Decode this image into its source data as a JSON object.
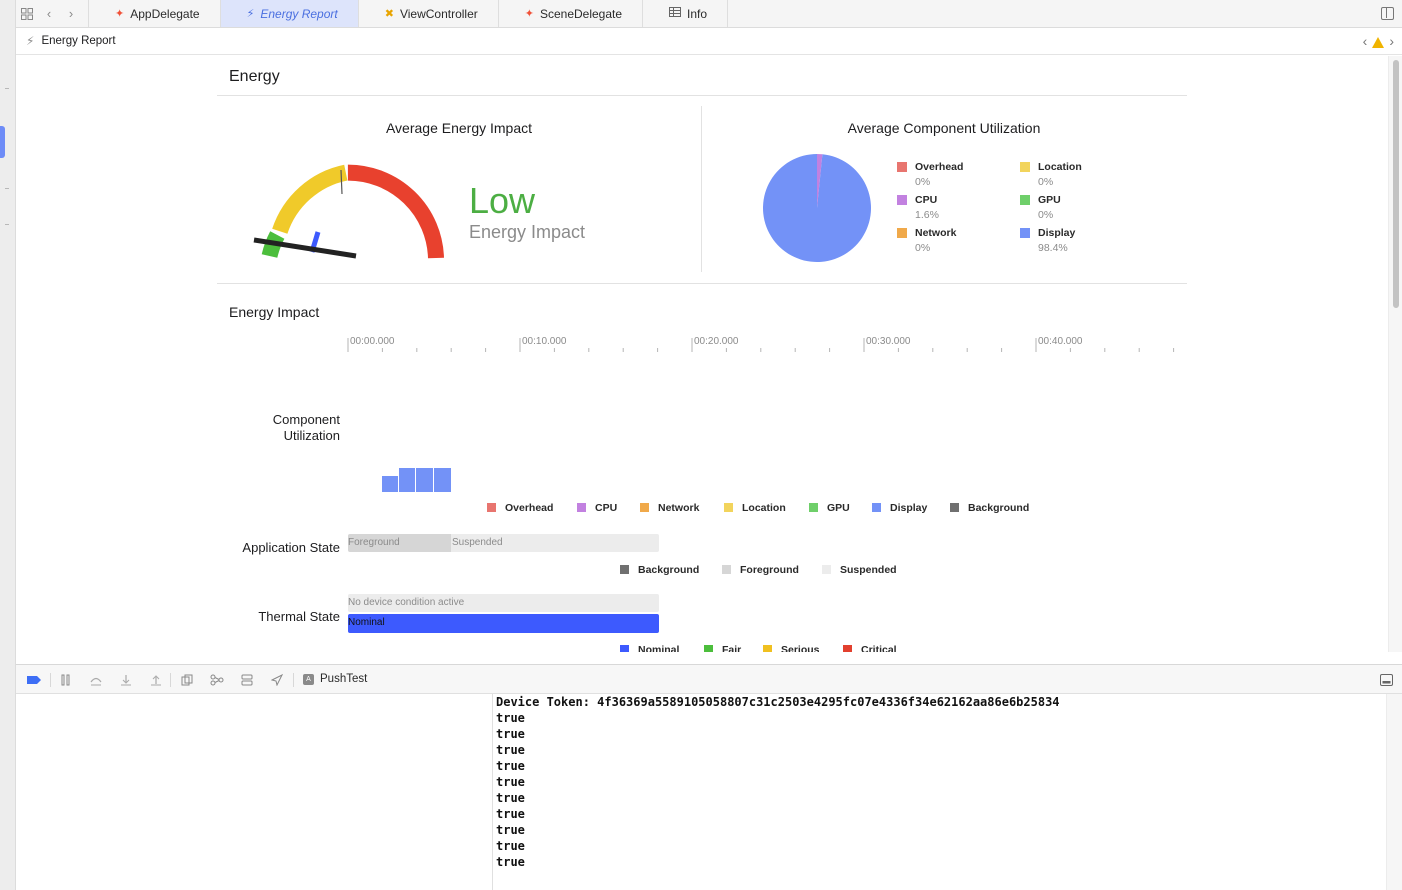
{
  "tabbar": {
    "tabs": [
      {
        "label": "AppDelegate",
        "icon": "swift-icon",
        "color": "#f05138"
      },
      {
        "label": "Energy Report",
        "icon": "bolt-icon",
        "active": true
      },
      {
        "label": "ViewController",
        "icon": "xib-icon",
        "color": "#e8a400"
      },
      {
        "label": "SceneDelegate",
        "icon": "swift-icon",
        "color": "#f05138"
      },
      {
        "label": "Info",
        "icon": "table-icon"
      }
    ]
  },
  "breadcrumb": {
    "label": "Energy Report"
  },
  "energy": {
    "title": "Energy",
    "avg_impact_heading": "Average Energy Impact",
    "impact_level": "Low",
    "impact_subtitle": "Energy Impact",
    "impact_level_fraction": 0.1,
    "avg_util_heading": "Average Component Utilization",
    "components": [
      {
        "name": "Overhead",
        "value": "0%",
        "pct": 0,
        "color": "#e8756f"
      },
      {
        "name": "Location",
        "value": "0%",
        "pct": 0,
        "color": "#f2d45c"
      },
      {
        "name": "CPU",
        "value": "1.6%",
        "pct": 1.6,
        "color": "#c281e0"
      },
      {
        "name": "GPU",
        "value": "0%",
        "pct": 0,
        "color": "#6fcf6a"
      },
      {
        "name": "Network",
        "value": "0%",
        "pct": 0,
        "color": "#f0a94a"
      },
      {
        "name": "Display",
        "value": "98.4%",
        "pct": 98.4,
        "color": "#7392f7"
      }
    ]
  },
  "timeline": {
    "title": "Energy Impact",
    "ticks": [
      "00:00.000",
      "00:10.000",
      "00:20.000",
      "00:30.000",
      "00:40.000"
    ],
    "rows": {
      "component_label": "Component Utilization",
      "app_state_label": "Application State",
      "thermal_label": "Thermal State"
    },
    "component_legend": [
      {
        "name": "Overhead",
        "color": "#e8756f"
      },
      {
        "name": "CPU",
        "color": "#c281e0"
      },
      {
        "name": "Network",
        "color": "#f0a94a"
      },
      {
        "name": "Location",
        "color": "#f2d45c"
      },
      {
        "name": "GPU",
        "color": "#6fcf6a"
      },
      {
        "name": "Display",
        "color": "#7392f7"
      },
      {
        "name": "Background",
        "color": "#707070"
      }
    ],
    "app_state_bars": {
      "foreground": "Foreground",
      "suspended": "Suspended"
    },
    "app_state_legend": [
      {
        "name": "Background",
        "color": "#707070"
      },
      {
        "name": "Foreground",
        "color": "#d6d6d6"
      },
      {
        "name": "Suspended",
        "color": "#ececec"
      }
    ],
    "thermal_bars": {
      "condition": "No device condition active",
      "nominal": "Nominal"
    },
    "thermal_legend": [
      {
        "name": "Nominal",
        "color": "#3d5afe"
      },
      {
        "name": "Fair",
        "color": "#4cbe3c"
      },
      {
        "name": "Serious",
        "color": "#f0c020"
      },
      {
        "name": "Critical",
        "color": "#e2402e"
      }
    ]
  },
  "debugbar": {
    "target": "PushTest"
  },
  "console": {
    "lines": [
      "Device Token: 4f36369a5589105058807c31c2503e4295fc07e4336f34e62162aa86e6b25834",
      "true",
      "true",
      "true",
      "true",
      "true",
      "true",
      "true",
      "true",
      "true",
      "true"
    ]
  },
  "colors": {
    "accent": "#4a6fe0",
    "impact_low": "#4cae43"
  }
}
